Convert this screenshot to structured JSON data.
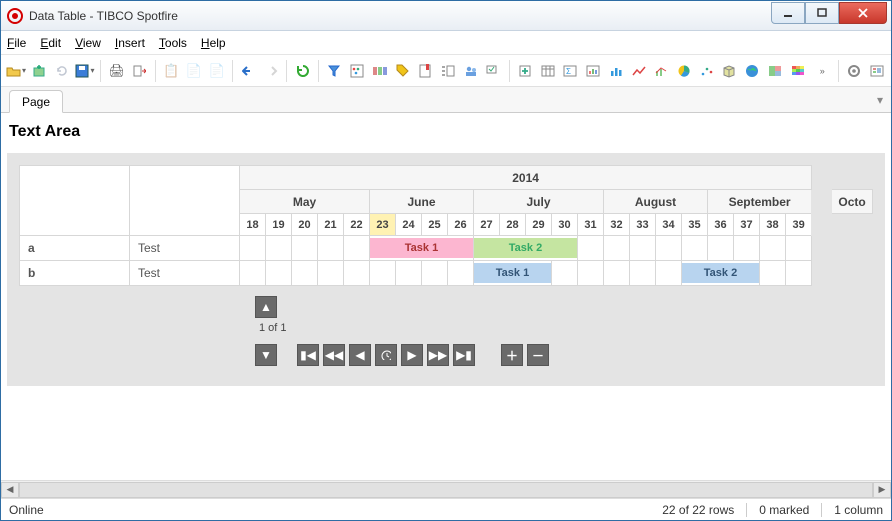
{
  "window": {
    "title": "Data Table - TIBCO Spotfire"
  },
  "menus": {
    "file": "File",
    "edit": "Edit",
    "view": "View",
    "insert": "Insert",
    "tools": "Tools",
    "help": "Help"
  },
  "tab": {
    "page": "Page"
  },
  "pane": {
    "title": "Text Area"
  },
  "gantt": {
    "year": "2014",
    "months": [
      "May",
      "June",
      "July",
      "August",
      "September",
      "Octo"
    ],
    "month_spans": [
      5,
      4,
      5,
      4,
      4,
      1
    ],
    "weeks": [
      "18",
      "19",
      "20",
      "21",
      "22",
      "23",
      "24",
      "25",
      "26",
      "27",
      "28",
      "29",
      "30",
      "31",
      "32",
      "33",
      "34",
      "35",
      "36",
      "37",
      "38",
      "39"
    ],
    "today_index": 5,
    "rows": [
      {
        "id": "a",
        "label": "Test",
        "bars": [
          {
            "start": 5,
            "span": 4,
            "text": "Task 1",
            "cls": "pink"
          },
          {
            "start": 9,
            "span": 4,
            "text": "Task 2",
            "cls": "green"
          }
        ]
      },
      {
        "id": "b",
        "label": "Test",
        "bars": [
          {
            "start": 9,
            "span": 3,
            "text": "Task 1",
            "cls": "blue"
          },
          {
            "start": 17,
            "span": 3,
            "text": "Task 2",
            "cls": "blue"
          }
        ]
      }
    ]
  },
  "pager": {
    "count": "1 of 1"
  },
  "status": {
    "online": "Online",
    "rows": "22 of 22 rows",
    "marked": "0 marked",
    "cols": "1 column"
  }
}
